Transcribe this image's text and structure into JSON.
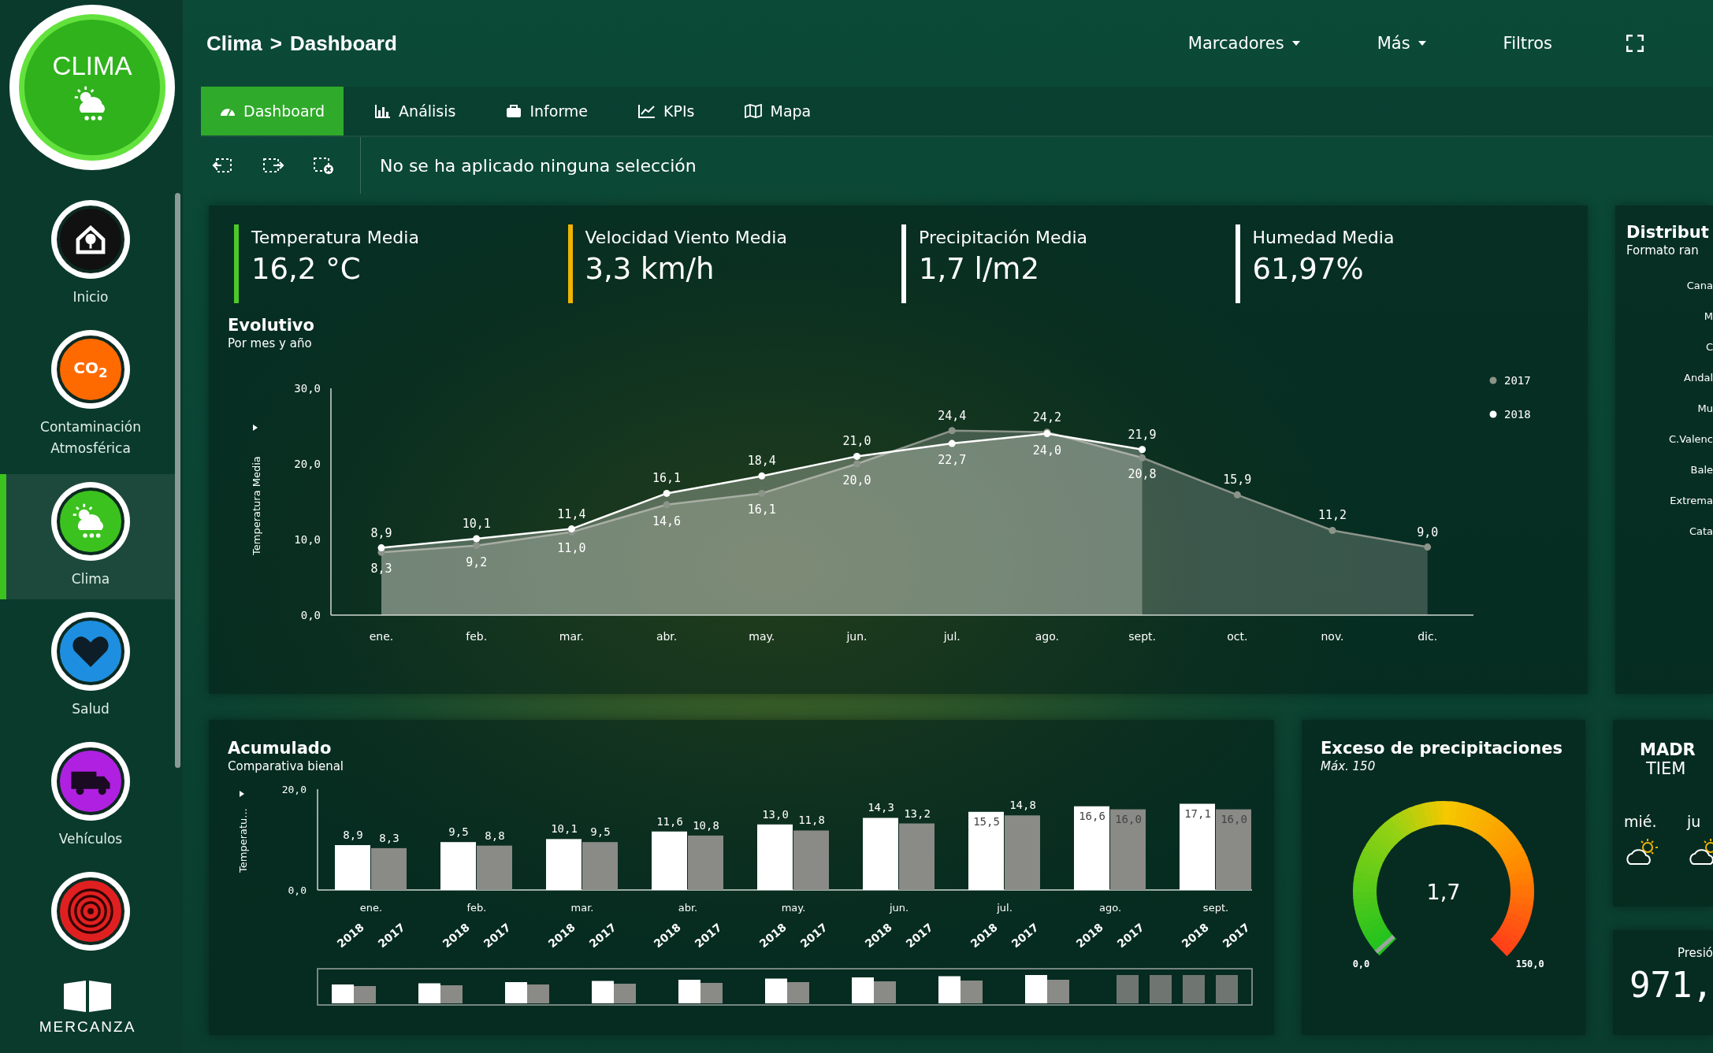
{
  "sidebar": {
    "logo": {
      "title": "CLIMA"
    },
    "items": [
      {
        "label": "Inicio",
        "kind": "home",
        "color": "#111111",
        "selected": false
      },
      {
        "label": "Contaminación Atmosférica",
        "kind": "co2",
        "icon_text": "CO$_{2}$",
        "color": "#ff6a00",
        "selected": false
      },
      {
        "label": "Clima",
        "kind": "weather",
        "color": "#3cc21e",
        "selected": true
      },
      {
        "label": "Salud",
        "kind": "heart",
        "color": "#1e8fe0",
        "selected": false
      },
      {
        "label": "Vehículos",
        "kind": "truck",
        "color": "#b020e0",
        "selected": false
      },
      {
        "kind": "target",
        "color": "#e02020",
        "selected": false
      }
    ],
    "brand": "MERCANZA"
  },
  "breadcrumb": {
    "items": [
      "Clima",
      "Dashboard"
    ],
    "separator": ">"
  },
  "top_nav": [
    {
      "label": "Marcadores",
      "dropdown": true
    },
    {
      "label": "Más",
      "dropdown": true
    },
    {
      "label": "Filtros",
      "dropdown": false
    }
  ],
  "tabs": [
    {
      "label": "Dashboard",
      "kind": "dashboard",
      "selected": true
    },
    {
      "label": "Análisis",
      "kind": "analysis",
      "selected": false
    },
    {
      "label": "Informe",
      "kind": "report",
      "selected": false
    },
    {
      "label": "KPIs",
      "kind": "kpi",
      "selected": false
    },
    {
      "label": "Mapa",
      "kind": "map",
      "selected": false
    }
  ],
  "selection_bar": {
    "message": "No se ha aplicado ninguna selección"
  },
  "kpis": [
    {
      "label": "Temperatura Media",
      "value": "16,2 °C",
      "color": "#4cc92a"
    },
    {
      "label": "Velocidad Viento Media",
      "value": "3,3 km/h",
      "color": "#f0b400"
    },
    {
      "label": "Precipitación Media",
      "value": "1,7 l/m2",
      "color": "#ffffff"
    },
    {
      "label": "Humedad Media",
      "value": "61,97%",
      "color": "#ffffff"
    }
  ],
  "evolutivo": {
    "title": "Evolutivo",
    "subtitle": "Por mes y año",
    "chart_data": {
      "type": "area",
      "ylabel": "Temperatura Media",
      "categories": [
        "ene.",
        "feb.",
        "mar.",
        "abr.",
        "may.",
        "jun.",
        "jul.",
        "ago.",
        "sept.",
        "oct.",
        "nov.",
        "dic."
      ],
      "series": [
        {
          "name": "2017",
          "color": "#8c948a",
          "values": [
            8.3,
            9.2,
            11.0,
            14.6,
            16.1,
            20.0,
            24.4,
            24.2,
            20.8,
            15.9,
            11.2,
            9.0
          ],
          "value_labels": [
            "8,3",
            "9,2",
            "11,0",
            "14,6",
            "16,1",
            "20,0",
            "24,4",
            "24,2",
            "20,8",
            "15,9",
            "11,2",
            "9,0"
          ]
        },
        {
          "name": "2018",
          "color": "#ffffff",
          "values": [
            8.9,
            10.1,
            11.4,
            16.1,
            18.4,
            21.0,
            22.7,
            24.0,
            21.9,
            null,
            null,
            null
          ],
          "value_labels": [
            "8,9",
            "10,1",
            "11,4",
            "16,1",
            "18,4",
            "21,0",
            "22,7",
            "24,0",
            "21,9",
            null,
            null,
            null
          ]
        }
      ],
      "ylim": [
        0,
        30
      ],
      "yticks": [
        {
          "value": 0,
          "label": "0,0"
        },
        {
          "value": 10,
          "label": "10,0"
        },
        {
          "value": 20,
          "label": "20,0"
        },
        {
          "value": 30,
          "label": "30,0"
        }
      ],
      "legend": "right"
    }
  },
  "distribution": {
    "title": "Distribut",
    "subtitle": "Formato ran",
    "labels": [
      "Cana",
      "M",
      "C",
      "Andal",
      "Mu",
      "C.Valenc",
      "Bale",
      "Extrema",
      "Cata"
    ]
  },
  "acumulado": {
    "title": "Acumulado",
    "subtitle": "Comparativa bienal",
    "chart_data": {
      "type": "bar",
      "ylabel": "Temperatu...",
      "categories": [
        "ene.",
        "feb.",
        "mar.",
        "abr.",
        "may.",
        "jun.",
        "jul.",
        "ago.",
        "sept."
      ],
      "series": [
        {
          "name": "2018",
          "color": "#ffffff",
          "values": [
            8.9,
            9.5,
            10.1,
            11.6,
            13.0,
            14.3,
            15.5,
            16.6,
            17.1
          ],
          "value_labels": [
            "8,9",
            "9,5",
            "10,1",
            "11,6",
            "13,0",
            "14,3",
            "15,5",
            "16,6",
            "17,1"
          ]
        },
        {
          "name": "2017",
          "color": "#8a8a86",
          "values": [
            8.3,
            8.8,
            9.5,
            10.8,
            11.8,
            13.2,
            14.8,
            16.0,
            16.0
          ],
          "value_labels": [
            "8,3",
            "8,8",
            "9,5",
            "10,8",
            "11,8",
            "13,2",
            "14,8",
            "16,0",
            "16,0"
          ]
        }
      ],
      "ylim": [
        0,
        20
      ],
      "yticks": [
        {
          "value": 0,
          "label": "0,0"
        },
        {
          "value": 20,
          "label": "20,0"
        }
      ]
    }
  },
  "gauge": {
    "title": "Exceso de precipitaciones",
    "subtitle": "Máx. 150",
    "value": "1,7",
    "min": "0,0",
    "max": "150,0"
  },
  "weather": {
    "city": "MADR",
    "subtitle": "TIEM",
    "days": [
      {
        "label": "mié."
      },
      {
        "label": "ju"
      }
    ]
  },
  "pressure": {
    "label": "Presió",
    "value": "971,"
  }
}
